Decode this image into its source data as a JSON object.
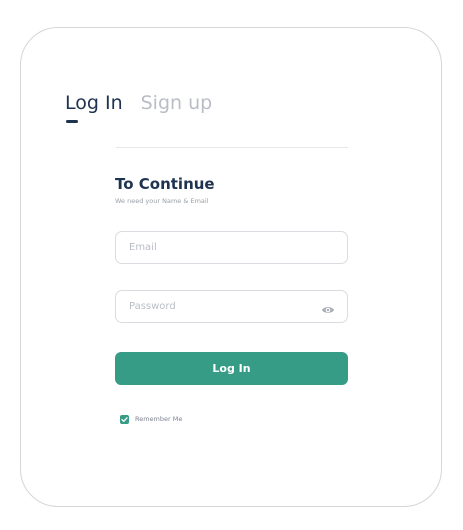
{
  "tabs": {
    "login_label": "Log In",
    "signup_label": "Sign up",
    "active": "login"
  },
  "form": {
    "title": "To Continue",
    "subtitle": "We need your Name & Email",
    "email_placeholder": "Email",
    "email_value": "",
    "password_placeholder": "Password",
    "password_value": "",
    "password_toggle_icon": "eye-icon",
    "submit_label": "Log In",
    "remember_label": "Remember Me",
    "remember_checked": true
  },
  "colors": {
    "primary": "#369c85",
    "heading": "#1d3350",
    "muted": "#b8bdc6",
    "border": "#d9dce0"
  }
}
